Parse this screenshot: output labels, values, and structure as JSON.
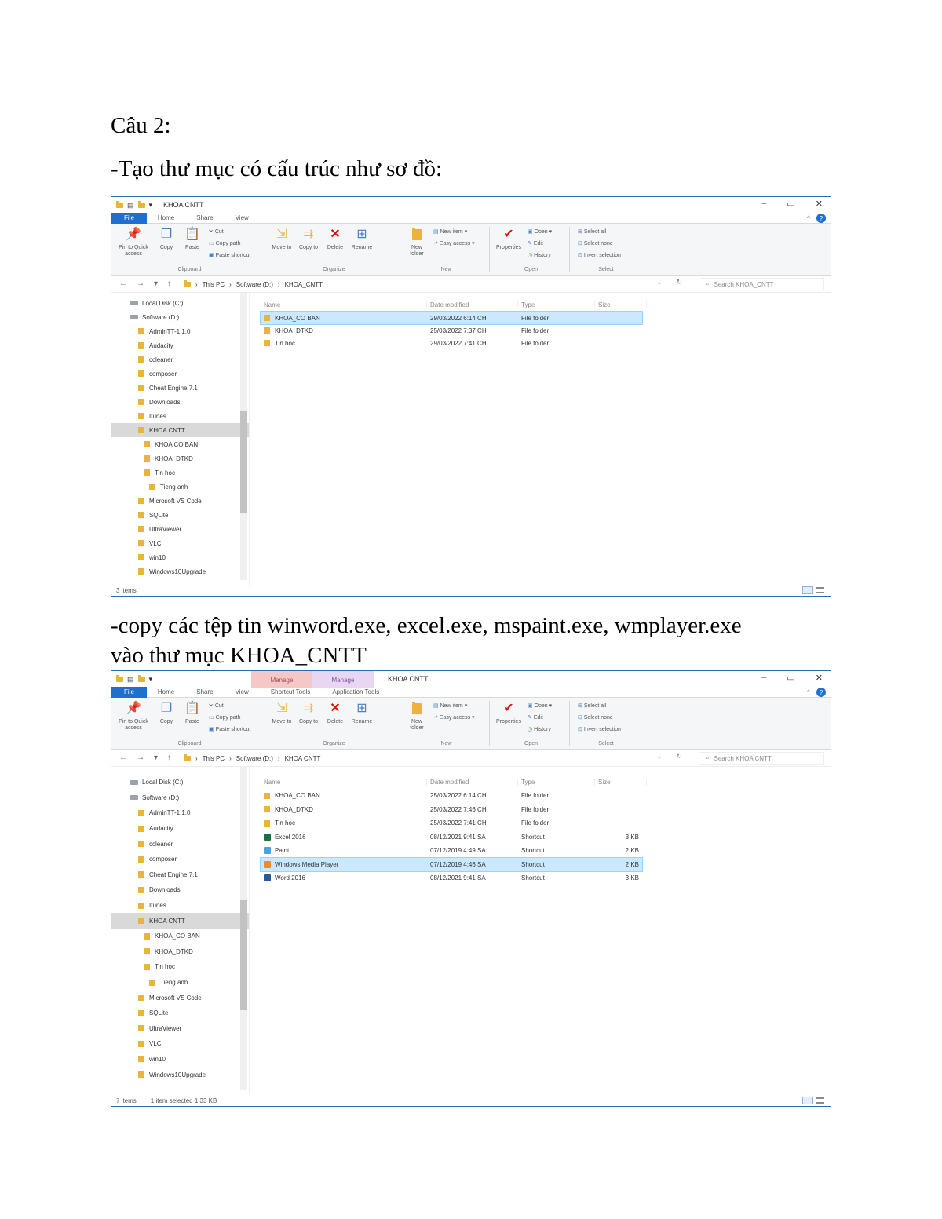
{
  "doc": {
    "heading": "Câu 2:",
    "line1": "-Tạo thư mục có cấu trúc như sơ đồ:",
    "line2": "-copy các tệp tin winword.exe, excel.exe, mspaint.exe, wmplayer.exe",
    "line3": "vào thư mục KHOA_CNTT"
  },
  "win1": {
    "title": "KHOA CNTT",
    "tabs": [
      "File",
      "Home",
      "Share",
      "View"
    ],
    "ribbon": {
      "pin": "Pin to Quick access",
      "copy": "Copy",
      "paste": "Paste",
      "cut": "Cut",
      "copy_path": "Copy path",
      "paste_shortcut": "Paste shortcut",
      "clipboard": "Clipboard",
      "move_to": "Move to",
      "copy_to": "Copy to",
      "delete": "Delete",
      "rename": "Rename",
      "organize": "Organize",
      "new_folder": "New folder",
      "new_item": "New item",
      "easy_access": "Easy access",
      "new": "New",
      "properties": "Properties",
      "open": "Open",
      "edit": "Edit",
      "history": "History",
      "open_group": "Open",
      "select_all": "Select all",
      "select_none": "Select none",
      "invert": "Invert selection",
      "select": "Select"
    },
    "path": [
      "This PC",
      "Software (D:)",
      "KHOA_CNTT"
    ],
    "search": "Search KHOA_CNTT",
    "tree": [
      {
        "label": "Local Disk (C:)",
        "indent": 0,
        "kind": "drive"
      },
      {
        "label": "Software (D:)",
        "indent": 0,
        "kind": "drive"
      },
      {
        "label": "AdminTT-1.1.0",
        "indent": 1,
        "kind": "folder"
      },
      {
        "label": "Audacity",
        "indent": 1,
        "kind": "folder"
      },
      {
        "label": "ccleaner",
        "indent": 1,
        "kind": "folder"
      },
      {
        "label": "composer",
        "indent": 1,
        "kind": "folder"
      },
      {
        "label": "Cheat Engine 7.1",
        "indent": 1,
        "kind": "folder"
      },
      {
        "label": "Downloads",
        "indent": 1,
        "kind": "folder"
      },
      {
        "label": "Itunes",
        "indent": 1,
        "kind": "folder"
      },
      {
        "label": "KHOA CNTT",
        "indent": 1,
        "kind": "folder",
        "selected": true
      },
      {
        "label": "KHOA CO BAN",
        "indent": 2,
        "kind": "folder"
      },
      {
        "label": "KHOA_DTKD",
        "indent": 2,
        "kind": "folder"
      },
      {
        "label": "Tin hoc",
        "indent": 2,
        "kind": "folder"
      },
      {
        "label": "Tieng anh",
        "indent": 3,
        "kind": "folder"
      },
      {
        "label": "Microsoft VS Code",
        "indent": 1,
        "kind": "folder"
      },
      {
        "label": "SQLite",
        "indent": 1,
        "kind": "folder"
      },
      {
        "label": "UltraViewer",
        "indent": 1,
        "kind": "folder"
      },
      {
        "label": "VLC",
        "indent": 1,
        "kind": "folder"
      },
      {
        "label": "win10",
        "indent": 1,
        "kind": "folder"
      },
      {
        "label": "Windows10Upgrade",
        "indent": 1,
        "kind": "folder"
      }
    ],
    "columns": [
      "Name",
      "Date modified",
      "Type",
      "Size"
    ],
    "rows": [
      {
        "name": "KHOA_CO BAN",
        "date": "29/03/2022 6:14 CH",
        "type": "File folder",
        "size": "",
        "kind": "folder",
        "selected": true
      },
      {
        "name": "KHOA_DTKD",
        "date": "25/03/2022 7:37 CH",
        "type": "File folder",
        "size": "",
        "kind": "folder"
      },
      {
        "name": "Tin hoc",
        "date": "29/03/2022 7:41 CH",
        "type": "File folder",
        "size": "",
        "kind": "folder"
      }
    ],
    "status": "3 items",
    "status2": ""
  },
  "win2": {
    "title": "KHOA CNTT",
    "ctx_tabs": [
      "Manage",
      "Manage"
    ],
    "tabs": [
      "File",
      "Home",
      "Share",
      "View",
      "Shortcut Tools",
      "Application Tools"
    ],
    "ribbon": {
      "pin": "Pin to Quick access",
      "copy": "Copy",
      "paste": "Paste",
      "cut": "Cut",
      "copy_path": "Copy path",
      "paste_shortcut": "Paste shortcut",
      "clipboard": "Clipboard",
      "move_to": "Move to",
      "copy_to": "Copy to",
      "delete": "Delete",
      "rename": "Rename",
      "organize": "Organize",
      "new_folder": "New folder",
      "new_item": "New item",
      "easy_access": "Easy access",
      "new": "New",
      "properties": "Properties",
      "open": "Open",
      "edit": "Edit",
      "history": "History",
      "open_group": "Open",
      "select_all": "Select all",
      "select_none": "Select none",
      "invert": "Invert selection",
      "select": "Select"
    },
    "path": [
      "This PC",
      "Software (D:)",
      "KHOA CNTT"
    ],
    "search": "Search KHOA CNTT",
    "tree": [
      {
        "label": "Local Disk (C:)",
        "indent": 0,
        "kind": "drive"
      },
      {
        "label": "Software (D:)",
        "indent": 0,
        "kind": "drive"
      },
      {
        "label": "AdminTT-1.1.0",
        "indent": 1,
        "kind": "folder"
      },
      {
        "label": "Audacity",
        "indent": 1,
        "kind": "folder"
      },
      {
        "label": "ccleaner",
        "indent": 1,
        "kind": "folder"
      },
      {
        "label": "composer",
        "indent": 1,
        "kind": "folder"
      },
      {
        "label": "Cheat Engine 7.1",
        "indent": 1,
        "kind": "folder"
      },
      {
        "label": "Downloads",
        "indent": 1,
        "kind": "folder"
      },
      {
        "label": "Itunes",
        "indent": 1,
        "kind": "folder"
      },
      {
        "label": "KHOA CNTT",
        "indent": 1,
        "kind": "folder",
        "selected": true
      },
      {
        "label": "KHOA_CO BAN",
        "indent": 2,
        "kind": "folder"
      },
      {
        "label": "KHOA_DTKD",
        "indent": 2,
        "kind": "folder"
      },
      {
        "label": "Tin hoc",
        "indent": 2,
        "kind": "folder"
      },
      {
        "label": "Tieng anh",
        "indent": 3,
        "kind": "folder"
      },
      {
        "label": "Microsoft VS Code",
        "indent": 1,
        "kind": "folder"
      },
      {
        "label": "SQLite",
        "indent": 1,
        "kind": "folder"
      },
      {
        "label": "UltraViewer",
        "indent": 1,
        "kind": "folder"
      },
      {
        "label": "VLC",
        "indent": 1,
        "kind": "folder"
      },
      {
        "label": "win10",
        "indent": 1,
        "kind": "folder"
      },
      {
        "label": "Windows10Upgrade",
        "indent": 1,
        "kind": "folder"
      }
    ],
    "columns": [
      "Name",
      "Date modified",
      "Type",
      "Size"
    ],
    "rows": [
      {
        "name": "KHOA_CO BAN",
        "date": "25/03/2022 6:14 CH",
        "type": "File folder",
        "size": "",
        "kind": "folder"
      },
      {
        "name": "KHOA_DTKD",
        "date": "25/03/2022 7:46 CH",
        "type": "File folder",
        "size": "",
        "kind": "folder"
      },
      {
        "name": "Tin hoc",
        "date": "25/03/2022 7:41 CH",
        "type": "File folder",
        "size": "",
        "kind": "folder"
      },
      {
        "name": "Excel 2016",
        "date": "08/12/2021 9:41 SA",
        "type": "Shortcut",
        "size": "3 KB",
        "kind": "excel"
      },
      {
        "name": "Paint",
        "date": "07/12/2019 4:49 SA",
        "type": "Shortcut",
        "size": "2 KB",
        "kind": "paint"
      },
      {
        "name": "Windows Media Player",
        "date": "07/12/2019 4:46 SA",
        "type": "Shortcut",
        "size": "2 KB",
        "kind": "wmp",
        "selected": true
      },
      {
        "name": "Word 2016",
        "date": "08/12/2021 9:41 SA",
        "type": "Shortcut",
        "size": "3 KB",
        "kind": "word"
      }
    ],
    "status": "7 items",
    "status2": "1 item selected  1,33 KB"
  },
  "colors": {
    "accent": "#1e6fd0",
    "folder": "#e8b53a",
    "selection": "#cce8ff",
    "excel": "#1d7044",
    "word": "#2b5797",
    "paint": "#4aa3df",
    "wmp": "#f08a24"
  }
}
